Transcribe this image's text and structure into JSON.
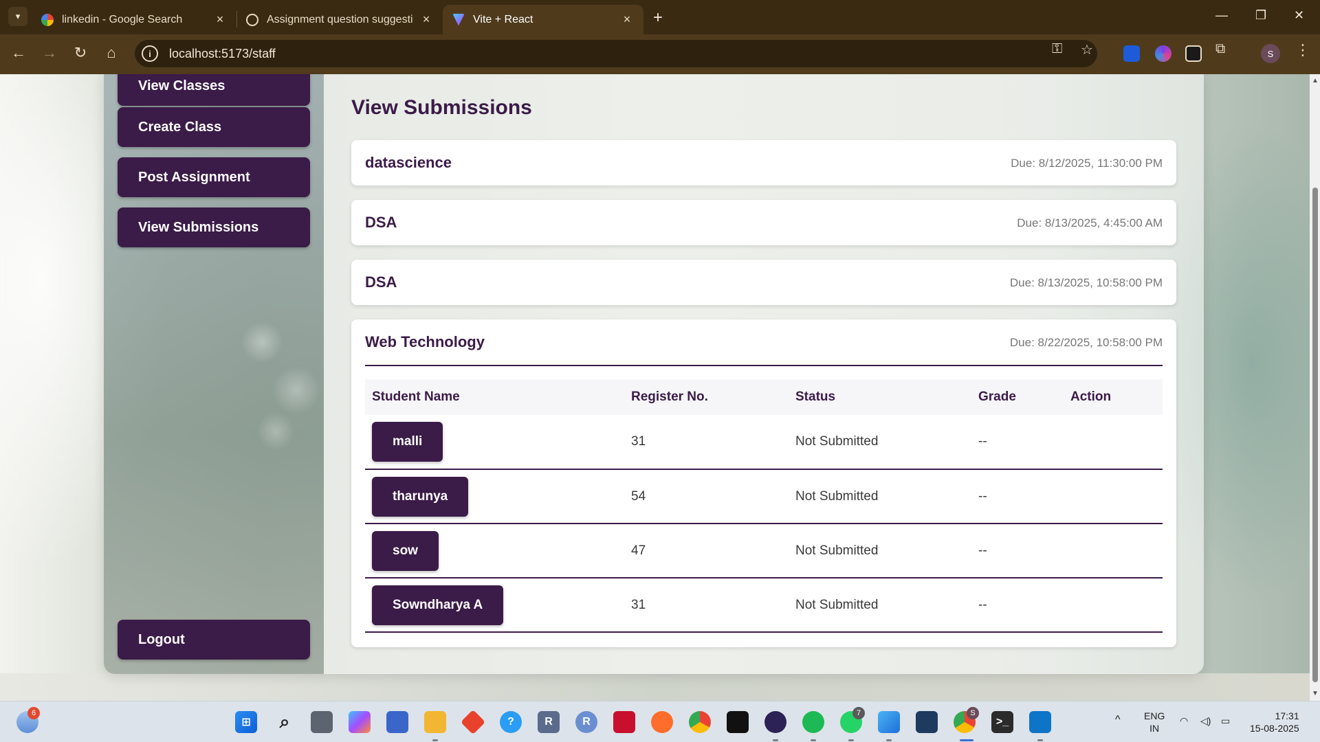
{
  "browser": {
    "tabs": [
      {
        "title": "linkedin - Google Search",
        "active": false
      },
      {
        "title": "Assignment question suggestion",
        "active": false
      },
      {
        "title": "Vite + React",
        "active": true
      }
    ],
    "url": "localhost:5173/staff",
    "profile_initial": "S",
    "new_tab_glyph": "+",
    "close_glyph": "×"
  },
  "sidebar": {
    "items": [
      {
        "label": "View Classes"
      },
      {
        "label": "Create Class"
      },
      {
        "label": "Post Assignment"
      },
      {
        "label": "View Submissions"
      }
    ],
    "logout_label": "Logout"
  },
  "main": {
    "title": "View Submissions",
    "assignments": [
      {
        "name": "datascience",
        "due": "Due: 8/12/2025, 11:30:00 PM"
      },
      {
        "name": "DSA",
        "due": "Due: 8/13/2025, 4:45:00 AM"
      },
      {
        "name": "DSA",
        "due": "Due: 8/13/2025, 10:58:00 PM"
      },
      {
        "name": "Web Technology",
        "due": "Due: 8/22/2025, 10:58:00 PM"
      }
    ],
    "table": {
      "headers": [
        "Student Name",
        "Register No.",
        "Status",
        "Grade",
        "Action"
      ],
      "rows": [
        {
          "student": "malli",
          "reg": "31",
          "status": "Not Submitted",
          "grade": "--",
          "action": ""
        },
        {
          "student": "tharunya",
          "reg": "54",
          "status": "Not Submitted",
          "grade": "--",
          "action": ""
        },
        {
          "student": "sow",
          "reg": "47",
          "status": "Not Submitted",
          "grade": "--",
          "action": ""
        },
        {
          "student": "Sowndharya A",
          "reg": "31",
          "status": "Not Submitted",
          "grade": "--",
          "action": ""
        }
      ]
    }
  },
  "taskbar": {
    "weather_badge": "6",
    "whatsapp_badge": "7",
    "chrome_badge": "S",
    "language": "ENG",
    "region": "IN",
    "time": "17:31",
    "date": "15-08-2025"
  },
  "colors": {
    "accent": "#3b1b48",
    "chrome_bg": "#3a2a12",
    "toolbar_bg": "#4f3b1c"
  }
}
